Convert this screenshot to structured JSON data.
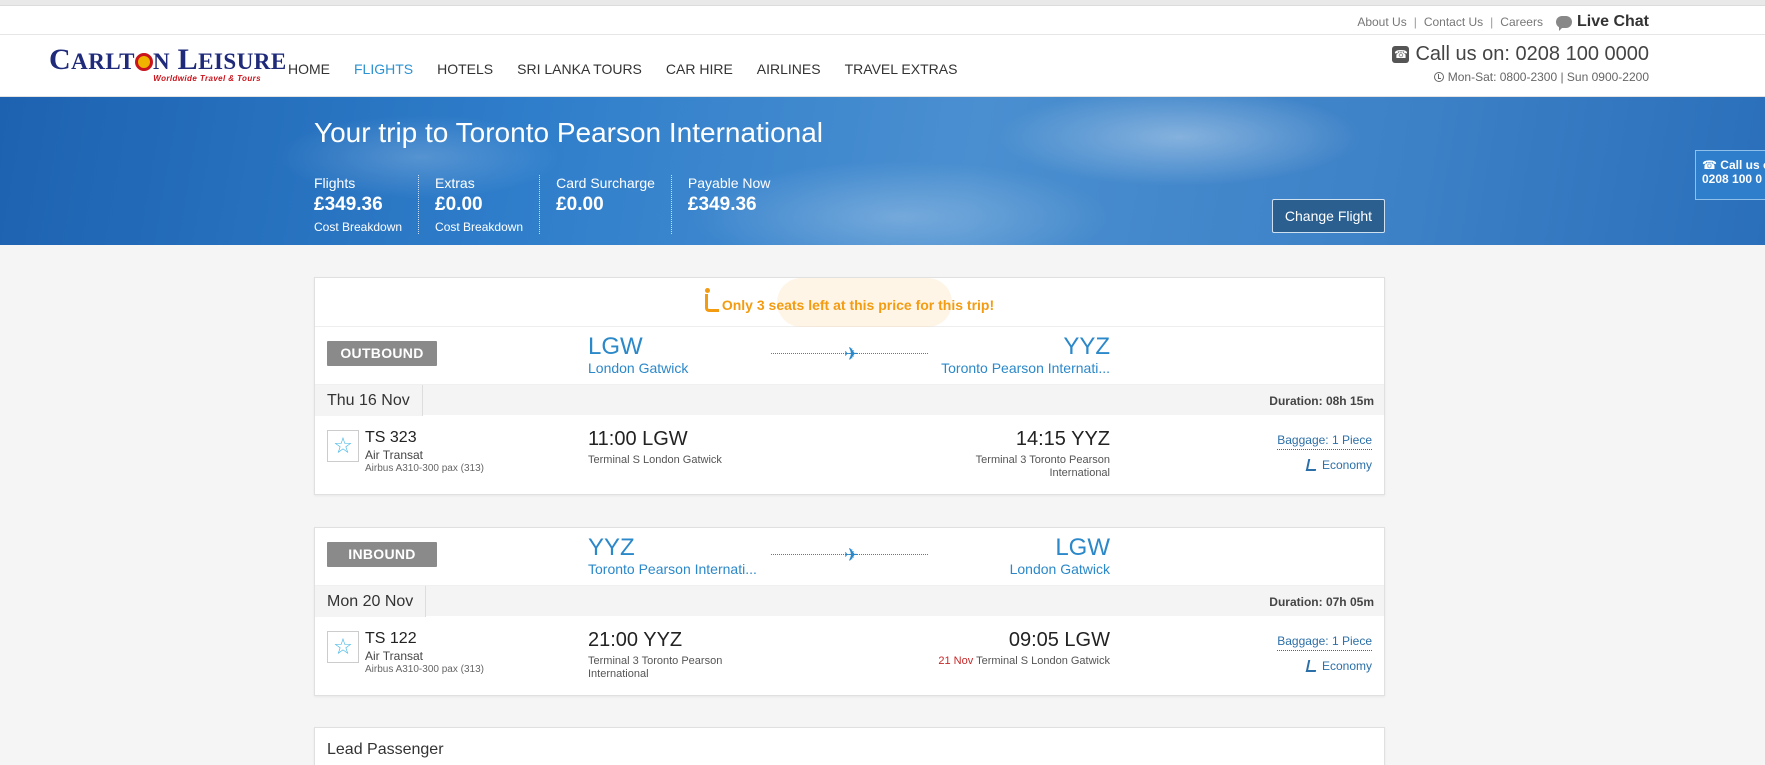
{
  "toplinks": {
    "about": "About Us",
    "contact": "Contact Us",
    "careers": "Careers",
    "sep": "|",
    "live_chat": "Live Chat"
  },
  "logo": {
    "word_c": "C",
    "word_arlt": "ARLT",
    "word_n": "N",
    "word_l": "L",
    "word_eisure": "EISURE",
    "tagline": "Worldwide Travel & Tours"
  },
  "nav": [
    "HOME",
    "FLIGHTS",
    "HOTELS",
    "SRI LANKA TOURS",
    "CAR HIRE",
    "AIRLINES",
    "TRAVEL EXTRAS"
  ],
  "nav_active_index": 1,
  "contact": {
    "call": "Call us on: 0208 100 0000",
    "hours": "Mon-Sat: 0800-2300 | Sun 0900-2200"
  },
  "banner": {
    "title": "Your trip to Toronto Pearson International",
    "costs": [
      {
        "label": "Flights",
        "value": "£349.36",
        "link": "Cost Breakdown"
      },
      {
        "label": "Extras",
        "value": "£0.00",
        "link": "Cost Breakdown"
      },
      {
        "label": "Card Surcharge",
        "value": "£0.00",
        "link": ""
      },
      {
        "label": "Payable Now",
        "value": "£349.36",
        "link": ""
      }
    ],
    "change_button": "Change Flight",
    "side_call_line1": "Call us o",
    "side_call_line2": "0208 100 0"
  },
  "seats_notice": "Only 3 seats left at this price for this trip!",
  "outbound": {
    "label": "OUTBOUND",
    "from_code": "LGW",
    "from_name": "London Gatwick",
    "to_code": "YYZ",
    "to_name": "Toronto Pearson Internati...",
    "date": "Thu 16 Nov",
    "duration": "Duration: 08h 15m",
    "flight_no": "TS 323",
    "carrier": "Air Transat",
    "aircraft": "Airbus A310-300 pax (313)",
    "dep_time": "11:00 LGW",
    "dep_terminal": "Terminal S London Gatwick",
    "arr_time": "14:15 YYZ",
    "arr_terminal_1": "Terminal 3 Toronto Pearson",
    "arr_terminal_2": "International",
    "baggage": "Baggage: 1 Piece",
    "cabin": "Economy"
  },
  "inbound": {
    "label": "INBOUND",
    "from_code": "YYZ",
    "from_name": "Toronto Pearson Internati...",
    "to_code": "LGW",
    "to_name": "London Gatwick",
    "date": "Mon 20 Nov",
    "duration": "Duration: 07h 05m",
    "flight_no": "TS 122",
    "carrier": "Air Transat",
    "aircraft": "Airbus A310-300 pax (313)",
    "dep_time": "21:00 YYZ",
    "dep_terminal_1": "Terminal 3 Toronto Pearson",
    "dep_terminal_2": "International",
    "arr_time": "09:05 LGW",
    "arr_date_note": "21 Nov",
    "arr_terminal": "Terminal S London Gatwick",
    "baggage": "Baggage: 1 Piece",
    "cabin": "Economy"
  },
  "lead_passenger": "Lead Passenger",
  "icons": {
    "phone": "phone-icon",
    "clock": "clock-icon",
    "chat": "chat-icon",
    "plane": "plane-icon",
    "seat": "seat-icon",
    "airline_star": "star-icon",
    "cabin_seat": "seat-icon"
  },
  "colors": {
    "brand_navy": "#1f2b7a",
    "brand_red": "#c9141d",
    "link_blue": "#2b88c9",
    "warning_orange": "#f39c12",
    "button_blue": "#2a5f90"
  }
}
